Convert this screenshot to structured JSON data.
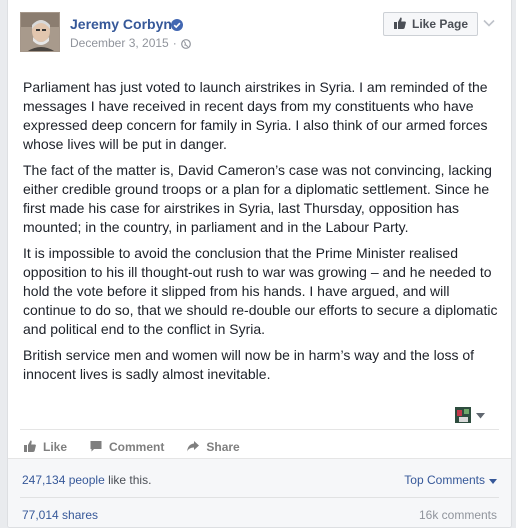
{
  "post": {
    "page_name": "Jeremy Corbyn",
    "date": "December 3, 2015",
    "separator": "·",
    "like_page_label": "Like Page",
    "paragraphs": [
      "Parliament has just voted to launch airstrikes in Syria. I am reminded of the messages I have received in recent days from my constituents who have expressed deep concern for family in Syria. I also think of our armed forces whose lives will be put in danger.",
      "The fact of the matter is, David Cameron’s case was not convincing, lacking either credible ground troops or a plan for a diplomatic settlement. Since he first made his case for airstrikes in Syria, last Thursday, opposition has mounted; in the country, in parliament and in the Labour Party.",
      "It is impossible to avoid the conclusion that the Prime Minister realised opposition to his ill thought-out rush to war was growing – and he needed to hold the vote before it slipped from his hands. I have argued, and will continue to do so, that we should re-double our efforts to secure a diplomatic and political end to the conflict in Syria.",
      "British service men and women will now be in harm’s way and the loss of innocent lives is sadly almost inevitable."
    ]
  },
  "actions": {
    "like": "Like",
    "comment": "Comment",
    "share": "Share"
  },
  "footer": {
    "likes_count": "247,134 people",
    "likes_suffix": " like this.",
    "top_comments": "Top Comments",
    "shares": "77,014 shares",
    "comments": "16k comments"
  },
  "icons": {
    "verified": "verified-badge-icon",
    "globe": "globe-icon",
    "like_page": "thumbs-up-icon",
    "menu": "chevron-down-icon"
  },
  "colors": {
    "link": "#365899",
    "text": "#1d2129",
    "muted": "#90949c",
    "verified": "#4267b2"
  }
}
